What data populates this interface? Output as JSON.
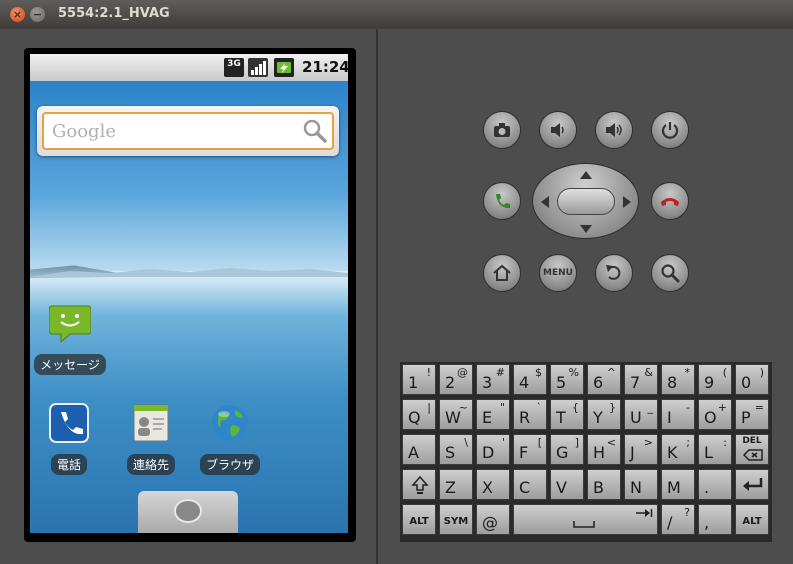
{
  "window": {
    "title": "5554:2.1_HVAG"
  },
  "statusbar": {
    "network": "3G",
    "time": "21:24"
  },
  "search": {
    "placeholder": "Google"
  },
  "apps": [
    {
      "label": "メッセージ",
      "icon": "messaging-icon"
    },
    {
      "label": "電話",
      "icon": "phone-icon"
    },
    {
      "label": "連絡先",
      "icon": "contacts-icon"
    },
    {
      "label": "ブラウザ",
      "icon": "browser-icon"
    }
  ],
  "controls": {
    "menu_label": "MENU"
  },
  "keyboard": {
    "row1": [
      [
        "1",
        "!"
      ],
      [
        "2",
        "@"
      ],
      [
        "3",
        "#"
      ],
      [
        "4",
        "$"
      ],
      [
        "5",
        "%"
      ],
      [
        "6",
        "^"
      ],
      [
        "7",
        "&"
      ],
      [
        "8",
        "*"
      ],
      [
        "9",
        "("
      ],
      [
        "0",
        ")"
      ]
    ],
    "row2": [
      [
        "Q",
        "|"
      ],
      [
        "W",
        "~"
      ],
      [
        "E",
        "\""
      ],
      [
        "R",
        "`"
      ],
      [
        "T",
        "{"
      ],
      [
        "Y",
        "}"
      ],
      [
        "U",
        "_"
      ],
      [
        "I",
        "-"
      ],
      [
        "O",
        "+"
      ],
      [
        "P",
        "="
      ]
    ],
    "row3": [
      [
        "A",
        ""
      ],
      [
        "S",
        "\\"
      ],
      [
        "D",
        "'"
      ],
      [
        "F",
        "["
      ],
      [
        "G",
        "]"
      ],
      [
        "H",
        "<"
      ],
      [
        "J",
        ">"
      ],
      [
        "K",
        ";"
      ],
      [
        "L",
        ":"
      ]
    ],
    "del_label": "DEL",
    "row4": [
      [
        "Z",
        ""
      ],
      [
        "X",
        ""
      ],
      [
        "C",
        ""
      ],
      [
        "V",
        ""
      ],
      [
        "B",
        ""
      ],
      [
        "N",
        ""
      ],
      [
        "M",
        ""
      ],
      [
        ".",
        ""
      ]
    ],
    "alt_label": "ALT",
    "sym_label": "SYM",
    "at_label": "@",
    "slash_label": "/",
    "question_label": "?",
    "comma_label": ","
  },
  "colors": {
    "accent": "#e8a040",
    "titlebar": "#3e3d39",
    "close": "#dd4814"
  }
}
